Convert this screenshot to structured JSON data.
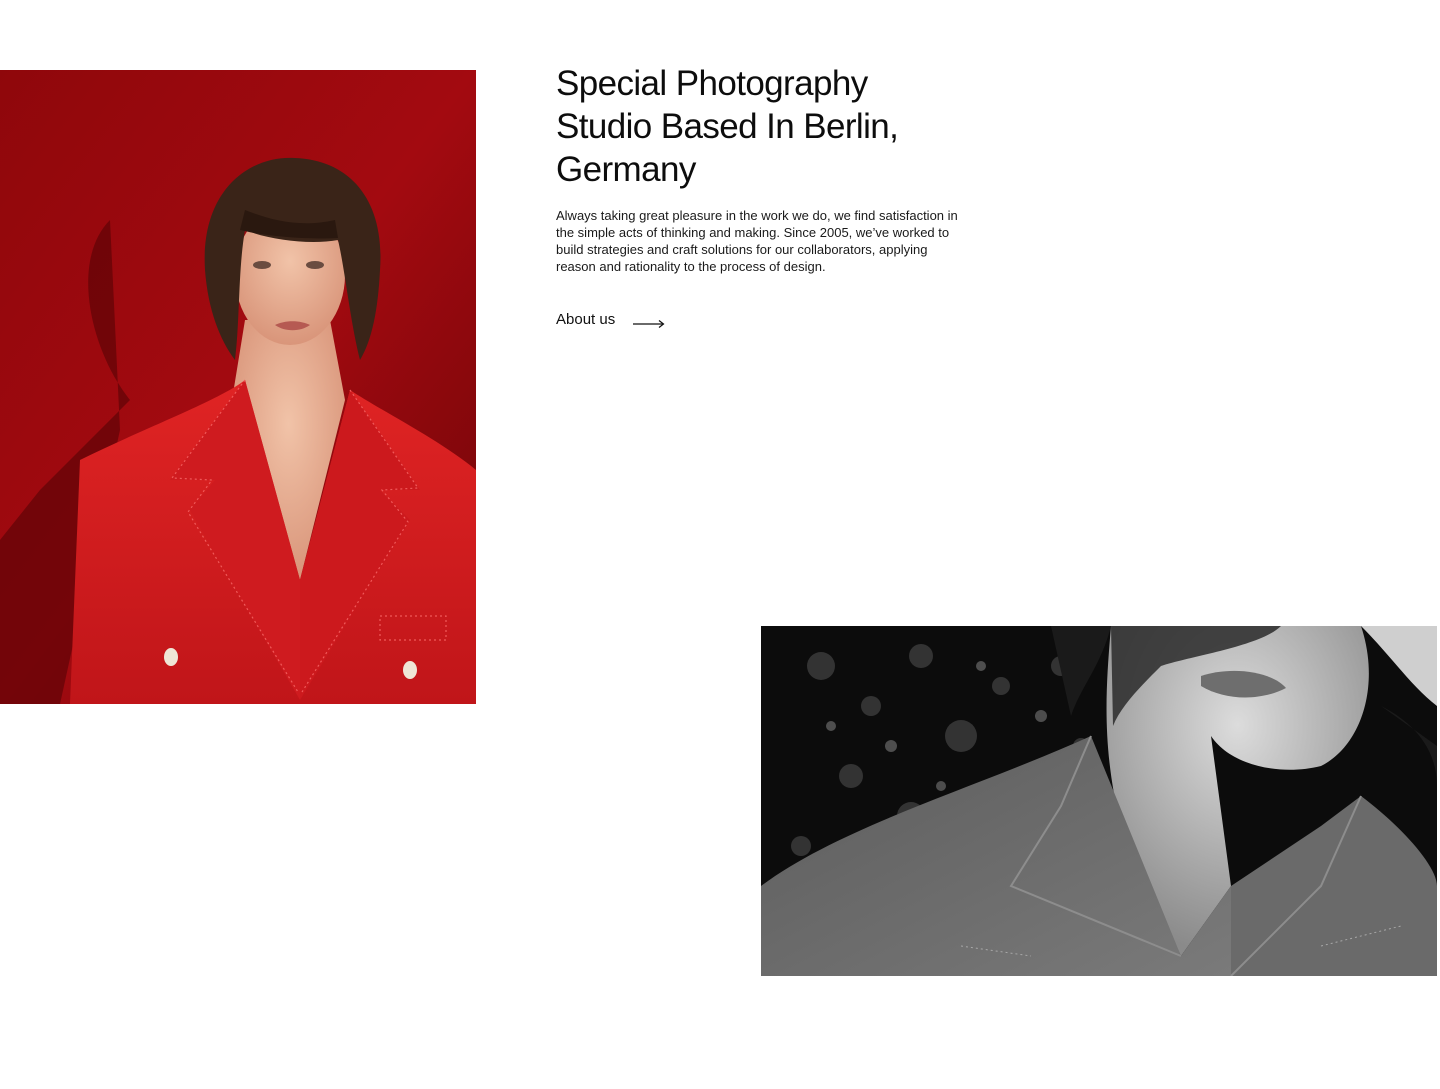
{
  "intro": {
    "title": "Special Photography Studio Based In Berlin, Germany",
    "text": "Always taking great pleasure in the work we do, we find satisfaction in the simple acts of thinking and making. Since 2005, we’ve worked to build strategies and craft solutions for our collaborators, applying reason and rationality to the process of design.",
    "link_label": "About us"
  },
  "icons": {
    "about_arrow": "arrow-right-icon"
  },
  "colors": {
    "accent_red": "#c8161c",
    "background_red": "#8e0a0e",
    "text": "#111111"
  }
}
